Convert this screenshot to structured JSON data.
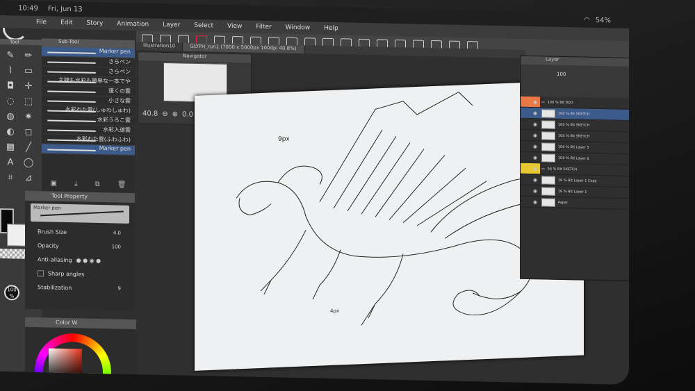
{
  "status": {
    "time": "10:49",
    "date": "Fri, Jun 13",
    "battery": "54%"
  },
  "menu": [
    "File",
    "Edit",
    "Story",
    "Animation",
    "Layer",
    "Select",
    "View",
    "Filter",
    "Window",
    "Help"
  ],
  "tabs": [
    {
      "label": "Illustration10"
    },
    {
      "label": "GLYPH_run1 (7000 x 5000px 100dpi 40.8%)"
    }
  ],
  "panels": {
    "tool": "Tool",
    "subtool": "Sub Tool",
    "tool_property": "Tool Property",
    "navigator": "Navigator",
    "layer": "Layer",
    "color": "Color W"
  },
  "subtools": [
    {
      "label": "Marker pen"
    },
    {
      "label": "さらペン"
    },
    {
      "label": "さらペン"
    },
    {
      "label": "主線も水彩も簡単な一本でや"
    },
    {
      "label": "速くの雲"
    },
    {
      "label": "小さな雲"
    },
    {
      "label": "水彩わた雲(しゅわしゅわ)"
    },
    {
      "label": "水彩うろこ雲"
    },
    {
      "label": "水彩入道雲"
    },
    {
      "label": "水彩わた雲(ふわふわ)"
    },
    {
      "label": "Marker pen"
    }
  ],
  "tool_property": {
    "brush_name": "Marker pen",
    "brush_size_label": "Brush Size",
    "brush_size": "4.0",
    "opacity_label": "Opacity",
    "opacity": "100",
    "aa_label": "Anti-aliasing",
    "sharp_label": "Sharp angles",
    "stab_label": "Stabilization",
    "stab_value": "9"
  },
  "zoom": "100 %",
  "navigator": {
    "zoom": "40.8",
    "rotation": "0.0"
  },
  "canvas_notes": [
    "9px",
    "4px"
  ],
  "layers": [
    {
      "label": "100 % Bit BOD"
    },
    {
      "label": "100 % Bit SKETCH"
    },
    {
      "label": "100 % Bit SKETCH"
    },
    {
      "label": "100 % Bit SKETCH"
    },
    {
      "label": "100 % Bit Layer 5"
    },
    {
      "label": "100 % Bit Layer 6"
    },
    {
      "label": "56 % Bit SKETCH"
    },
    {
      "label": "16 % Bit Layer 1 Copy"
    },
    {
      "label": "16 % Bit Layer 1"
    },
    {
      "label": "Paper"
    }
  ],
  "layer_opacity": "100"
}
